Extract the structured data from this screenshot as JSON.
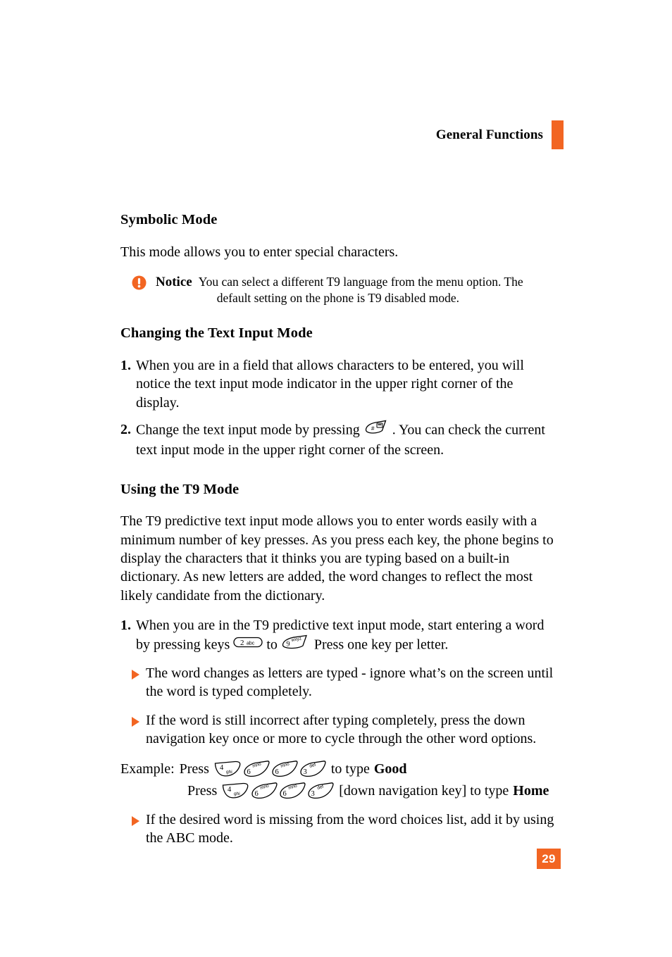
{
  "header": {
    "title": "General Functions",
    "marker_color": "#F26522"
  },
  "accent_color": "#F26522",
  "sections": {
    "symbolic_mode": {
      "heading": "Symbolic Mode",
      "paragraph": "This mode allows you to enter special characters."
    },
    "notice": {
      "label": "Notice",
      "line1": "You can select a different T9 language from the menu option. The",
      "line2": "default setting on the phone is T9 disabled mode.",
      "icon": "exclamation-circle-icon"
    },
    "changing_text_input_mode": {
      "heading": "Changing the Text Input Mode",
      "items": [
        {
          "number": "1.",
          "text": "When you are in a field that allows characters to be entered, you will notice the text input mode indicator in the upper right corner of the display."
        },
        {
          "number": "2.",
          "text_before": "Change the text input mode by pressing",
          "key": {
            "number": "#",
            "letters": "",
            "style": "slanted",
            "icon": "hash-key-icon"
          },
          "text_after": ". You can check the current text input mode in the upper right corner of the screen."
        }
      ]
    },
    "using_t9_mode": {
      "heading": "Using the T9 Mode",
      "paragraph": "The T9 predictive text input mode allows you to enter words easily with a minimum number of key presses. As you press each key, the phone begins to display the characters that it thinks you are typing based on a built-in dictionary. As new letters are added, the word changes to reflect the most likely candidate from the dictionary.",
      "step1": {
        "number": "1.",
        "text_before": "When you are in the T9 predictive text input mode, start entering a word by pressing keys",
        "key_from": {
          "number": "2",
          "letters": "abc",
          "style": "pill"
        },
        "text_middle": "to",
        "key_to": {
          "number": "9",
          "letters": "wxyz",
          "style": "slanted"
        },
        "text_after": "Press one key per letter."
      },
      "bullets": [
        "The word changes as letters are typed - ignore what’s on the screen until the word is typed completely.",
        "If the word is still incorrect after typing completely, press the down navigation key once or more to cycle through the other word options."
      ],
      "example": {
        "label": "Example:",
        "press_label": "Press",
        "row1": {
          "keys": [
            {
              "number": "4",
              "letters": "ghi",
              "variant": "up"
            },
            {
              "number": "6",
              "letters": "mno",
              "variant": "down"
            },
            {
              "number": "6",
              "letters": "mno",
              "variant": "down"
            },
            {
              "number": "3",
              "letters": "def",
              "variant": "down"
            }
          ],
          "tail_before": "to type",
          "tail_bold": "Good"
        },
        "row2": {
          "keys": [
            {
              "number": "4",
              "letters": "ghi",
              "variant": "up"
            },
            {
              "number": "6",
              "letters": "mno",
              "variant": "down"
            },
            {
              "number": "6",
              "letters": "mno",
              "variant": "down"
            },
            {
              "number": "3",
              "letters": "def",
              "variant": "down"
            }
          ],
          "tail_before": "[down navigation key] to type",
          "tail_bold": "Home"
        }
      },
      "final_bullet": "If the desired word is missing from the word choices list, add it by using the ABC mode."
    }
  },
  "page_number": "29"
}
